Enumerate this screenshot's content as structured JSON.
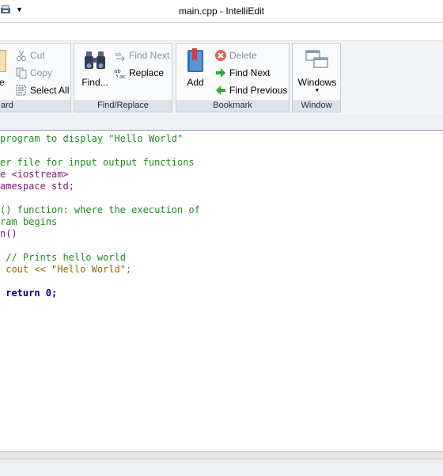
{
  "window": {
    "title": "main.cpp - IntelliEdit"
  },
  "ribbon": {
    "clipboard": {
      "label": "ard",
      "paste_label": "e",
      "cut": "Cut",
      "copy": "Copy",
      "select_all": "Select All"
    },
    "find_replace": {
      "label": "Find/Replace",
      "find": "Find...",
      "find_next": "Find Next",
      "replace": "Replace"
    },
    "bookmark": {
      "label": "Bookmark",
      "add": "Add",
      "delete": "Delete",
      "find_next": "Find Next",
      "find_previous": "Find Previous"
    },
    "window": {
      "label": "Window",
      "windows": "Windows"
    }
  },
  "editor": {
    "lines": [
      "program to display \"Hello World\"",
      "",
      "er file for input output functions",
      "e <iostream>",
      "amespace std;",
      "",
      "() function: where the execution of",
      "ram begins",
      "n()",
      "",
      " // Prints hello world",
      " cout << \"Hello World\";",
      "",
      " return 0;"
    ]
  },
  "colors": {
    "accent": "#dde3ea",
    "comment": "#228b22",
    "keyword": "#7a1a7a",
    "string": "#8b6c00",
    "number": "#2a7ab5"
  }
}
